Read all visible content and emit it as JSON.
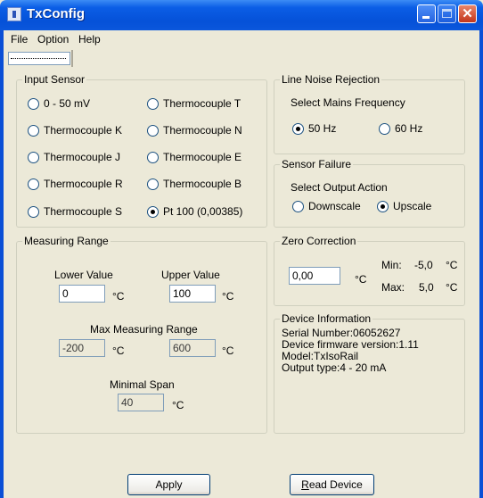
{
  "window": {
    "title": "TxConfig"
  },
  "menu": [
    "File",
    "Option",
    "Help"
  ],
  "input_sensor": {
    "title": "Input Sensor",
    "options": [
      {
        "label": "0 - 50 mV",
        "selected": false
      },
      {
        "label": "Thermocouple T",
        "selected": false
      },
      {
        "label": "Thermocouple K",
        "selected": false
      },
      {
        "label": "Thermocouple N",
        "selected": false
      },
      {
        "label": "Thermocouple J",
        "selected": false
      },
      {
        "label": "Thermocouple E",
        "selected": false
      },
      {
        "label": "Thermocouple R",
        "selected": false
      },
      {
        "label": "Thermocouple B",
        "selected": false
      },
      {
        "label": "Thermocouple S",
        "selected": false
      },
      {
        "label": "Pt 100 (0,00385)",
        "selected": true
      }
    ]
  },
  "line_noise": {
    "title": "Line Noise Rejection",
    "subtitle": "Select Mains Frequency",
    "options": [
      {
        "label": "50 Hz",
        "selected": true
      },
      {
        "label": "60 Hz",
        "selected": false
      }
    ]
  },
  "sensor_failure": {
    "title": "Sensor Failure",
    "subtitle": "Select Output Action",
    "options": [
      {
        "label": "Downscale",
        "selected": false
      },
      {
        "label": "Upscale",
        "selected": true
      }
    ]
  },
  "measuring_range": {
    "title": "Measuring Range",
    "lower_label": "Lower Value",
    "lower_value": "0",
    "upper_label": "Upper Value",
    "upper_value": "100",
    "unit": "°C",
    "max_label": "Max Measuring Range",
    "max_low": "-200",
    "max_high": "600",
    "span_label": "Minimal Span",
    "span_value": "40"
  },
  "zero_correction": {
    "title": "Zero Correction",
    "value": "0,00",
    "unit": "°C",
    "min_label": "Min:",
    "min_value": "-5,0",
    "max_label": "Max:",
    "max_value": "5,0"
  },
  "device_info": {
    "title": "Device Information",
    "lines": [
      "Serial Number:06052627",
      "Device firmware version:1.11",
      "Model:TxIsoRail",
      "Output type:4 - 20 mA"
    ]
  },
  "buttons": {
    "apply": "Apply",
    "read_prefix": "R",
    "read_rest": "ead Device"
  }
}
